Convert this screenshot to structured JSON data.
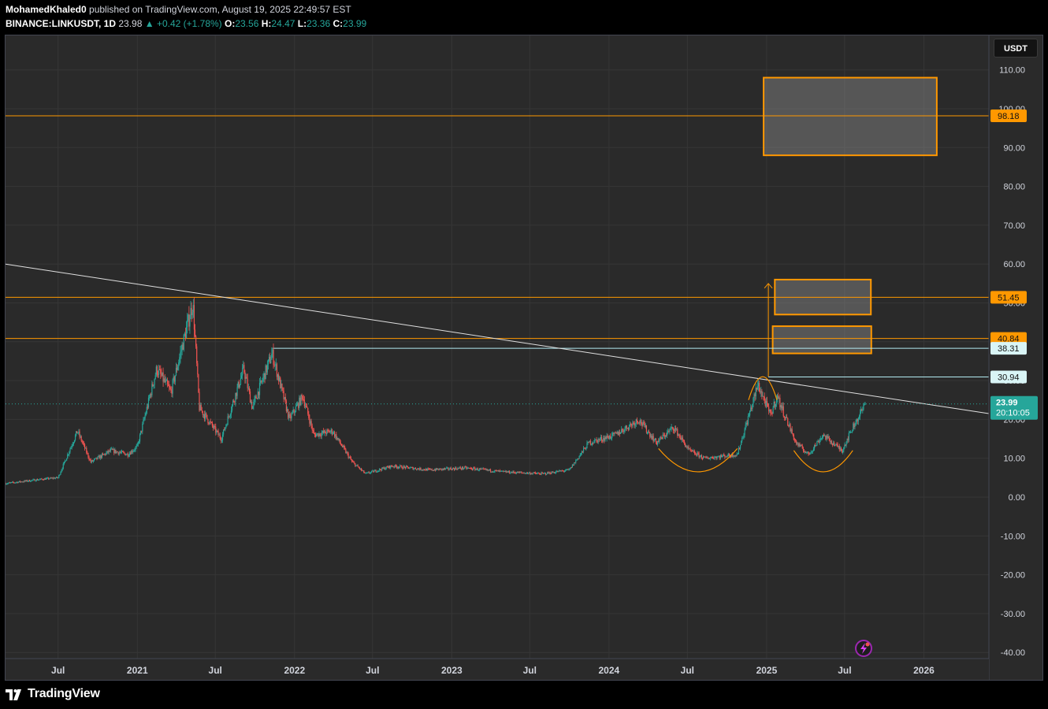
{
  "header": {
    "author": "MohamedKhaled0",
    "published": "published on TradingView.com, August 19, 2025 22:49:57 EST",
    "symbol": "BINANCE:LINKUSDT, 1D",
    "last": "23.98",
    "change": "▲ +0.42 (+1.78%)",
    "o_label": "O:",
    "o_value": "23.56",
    "h_label": "H:",
    "h_value": "24.47",
    "l_label": "L:",
    "l_value": "23.36",
    "c_label": "C:",
    "c_value": "23.99"
  },
  "unit": "USDT",
  "brand": "TradingView",
  "colors": {
    "background": "#2a2a2a",
    "up": "#26a69a",
    "down": "#ef5350",
    "level": "#ff9800",
    "trendline": "#e0e0e0",
    "teal_line": "#b2ebf2"
  },
  "chart_data": {
    "type": "candlestick",
    "timeframe": "1D",
    "symbol": "BINANCE:LINKUSDT",
    "ylim": [
      -40,
      110
    ],
    "y_ticks": [
      "110.00",
      "100.00",
      "90.00",
      "80.00",
      "70.00",
      "60.00",
      "50.00",
      "40.00",
      "30.00",
      "20.00",
      "10.00",
      "0.00",
      "-10.00",
      "-20.00",
      "-30.00",
      "-40.00"
    ],
    "x_ticks": [
      "Jul",
      "2021",
      "Jul",
      "2022",
      "Jul",
      "2023",
      "Jul",
      "2024",
      "Jul",
      "2025",
      "Jul",
      "2026"
    ],
    "x_range": [
      "2020-03-01",
      "2026-06-01"
    ],
    "price_path": [
      [
        "2020-03-01",
        3.5
      ],
      [
        "2020-05-15",
        4.5
      ],
      [
        "2020-07-01",
        5
      ],
      [
        "2020-08-15",
        17
      ],
      [
        "2020-09-15",
        9
      ],
      [
        "2020-11-01",
        12
      ],
      [
        "2020-12-10",
        11
      ],
      [
        "2021-01-01",
        13
      ],
      [
        "2021-02-15",
        33
      ],
      [
        "2021-03-20",
        27
      ],
      [
        "2021-05-10",
        50
      ],
      [
        "2021-05-25",
        23
      ],
      [
        "2021-07-15",
        15
      ],
      [
        "2021-09-05",
        33
      ],
      [
        "2021-09-25",
        23
      ],
      [
        "2021-11-10",
        37
      ],
      [
        "2021-12-20",
        20
      ],
      [
        "2022-01-20",
        26
      ],
      [
        "2022-02-15",
        16
      ],
      [
        "2022-03-30",
        17
      ],
      [
        "2022-05-15",
        9
      ],
      [
        "2022-06-15",
        6
      ],
      [
        "2022-08-15",
        8
      ],
      [
        "2022-11-10",
        7
      ],
      [
        "2023-02-01",
        7.5
      ],
      [
        "2023-05-01",
        6.5
      ],
      [
        "2023-08-01",
        6
      ],
      [
        "2023-10-01",
        7
      ],
      [
        "2023-11-15",
        14
      ],
      [
        "2024-01-15",
        16
      ],
      [
        "2024-03-10",
        20
      ],
      [
        "2024-04-20",
        14
      ],
      [
        "2024-05-30",
        18
      ],
      [
        "2024-07-05",
        12
      ],
      [
        "2024-08-10",
        10
      ],
      [
        "2024-10-25",
        11
      ],
      [
        "2024-12-12",
        29
      ],
      [
        "2025-01-10",
        21
      ],
      [
        "2025-01-25",
        26
      ],
      [
        "2025-03-10",
        14
      ],
      [
        "2025-04-08",
        11
      ],
      [
        "2025-05-12",
        16
      ],
      [
        "2025-06-25",
        12
      ],
      [
        "2025-07-20",
        18
      ],
      [
        "2025-08-19",
        24
      ]
    ],
    "last_price": {
      "value": 23.99,
      "label": "23.99",
      "countdown": "20:10:05"
    },
    "levels": [
      {
        "value": 98.18,
        "label": "98.18",
        "color": "#ff9800"
      },
      {
        "value": 51.45,
        "label": "51.45",
        "color": "#ff9800"
      },
      {
        "value": 40.84,
        "label": "40.84",
        "color": "#ff9800"
      },
      {
        "value": 38.31,
        "label": "38.31",
        "color": "#b2ebf2"
      },
      {
        "value": 30.94,
        "label": "30.94",
        "color": "#b2ebf2"
      }
    ],
    "zones": [
      {
        "from": "2024-12-25",
        "to": "2026-01-31",
        "y_low": 88,
        "y_high": 108
      },
      {
        "from": "2025-01-20",
        "to": "2025-08-31",
        "y_low": 47,
        "y_high": 56
      },
      {
        "from": "2025-01-15",
        "to": "2025-09-01",
        "y_low": 37,
        "y_high": 44
      }
    ],
    "trendline": {
      "from": [
        "2020-03-01",
        60
      ],
      "to": [
        "2026-06-01",
        21.5
      ]
    },
    "teal_segment": {
      "from": [
        "2021-11-10",
        38.31
      ],
      "to": [
        "2026-06-01",
        38.31
      ]
    },
    "arrow": {
      "date": "2025-01-05",
      "from": 31,
      "to": 55
    },
    "arcs": [
      {
        "from": "2024-04-25",
        "to": "2024-10-25",
        "y_bottom": 6.5,
        "y_top": 12.5
      },
      {
        "from": "2025-03-05",
        "to": "2025-07-20",
        "y_bottom": 6.5,
        "y_top": 12
      },
      {
        "from": "2024-11-20",
        "to": "2025-01-25",
        "y_bottom": 25,
        "y_top": 31
      }
    ],
    "grid": true
  }
}
